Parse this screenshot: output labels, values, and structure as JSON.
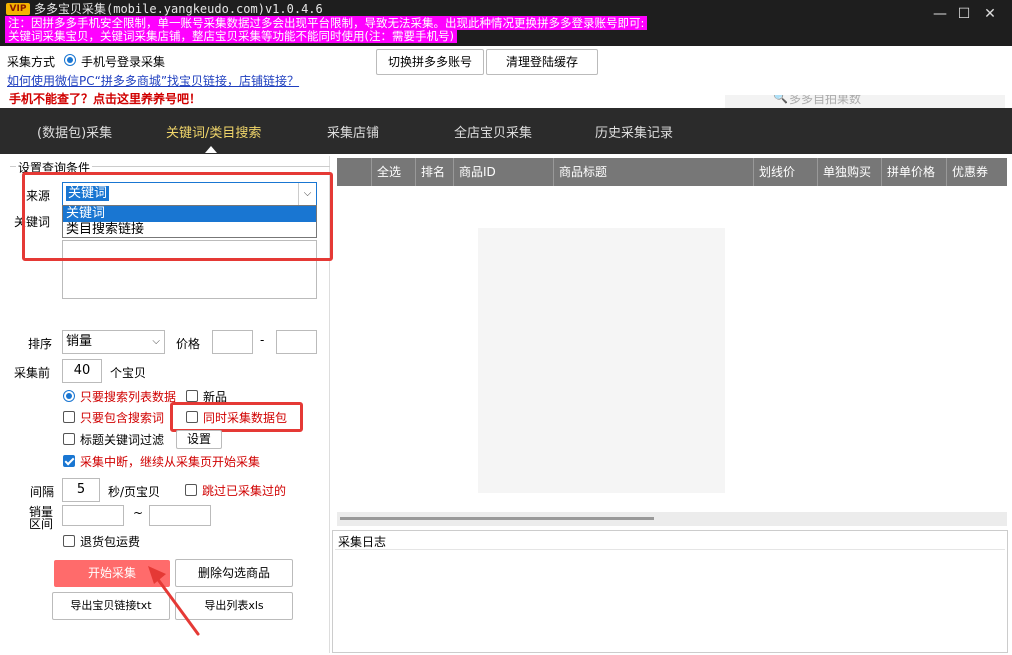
{
  "window": {
    "vip_badge": "VIP",
    "title": "多多宝贝采集(mobile.yangkeudo.com)v1.0.4.6",
    "notice_line1": "注：因拼多多手机安全限制，单一账号采集数据过多会出现平台限制，导致无法采集。出现此种情况更换拼多多登录账号即可:",
    "notice_line2": "关键词采集宝贝，关键词采集店铺，整店宝贝采集等功能不能同时使用(注：需要手机号)",
    "minimize": "—",
    "maximize": "☐",
    "close": "✕"
  },
  "top": {
    "mode_label": "采集方式",
    "mode_option": "手机号登录采集",
    "help_link": "如何使用微信PC“拼多多商城”找宝贝链接，店铺链接？",
    "warning_link": "手机不能查了？点击这里养养号吧！",
    "switch_button": "切换拼多多账号",
    "clear_button": "清理登陆缓存",
    "search_placeholder": "多多自拍果数"
  },
  "nav": {
    "tabs": [
      "(数据包)采集",
      "关键词/类目搜索",
      "采集店铺",
      "全店宝贝采集",
      "历史采集记录"
    ]
  },
  "left": {
    "group_title": "设置查询条件",
    "source_label": "来源",
    "source_value": "关键词",
    "source_options": [
      "关键词",
      "类目搜索链接"
    ],
    "keyword_label": "关键词",
    "sort_label": "排序",
    "sort_value": "销量",
    "price_label": "价格",
    "price_dash": "-",
    "collect_before_label": "采集前",
    "collect_count": "40",
    "collect_unit": "个宝贝",
    "opt_search_list": "只要搜索列表数据",
    "opt_new": "新品",
    "opt_contains_keyword": "只要包含搜索词",
    "opt_sync_packet": "同时采集数据包",
    "opt_title_filter": "标题关键词过滤",
    "settings_button": "设置",
    "opt_resume": "采集中断，继续从采集页开始采集",
    "interval_label": "间隔",
    "interval_value": "5",
    "interval_unit": "秒/页宝贝",
    "skip_collected": "跳过已采集过的",
    "sales_range_label": "销量区间",
    "tilde": "~",
    "return_shipping": "退货包运费",
    "start_button": "开始采集",
    "delete_button": "删除勾选商品",
    "export_txt_button": "导出宝贝链接txt",
    "export_xls_button": "导出列表xls"
  },
  "table": {
    "columns": [
      "全选",
      "排名",
      "商品ID",
      "商品标题",
      "划线价",
      "单独购买",
      "拼单价格",
      "优惠券"
    ]
  },
  "log": {
    "title": "采集日志"
  },
  "colors": {
    "accent": "#1976d2",
    "start_button": "#ff6b6b",
    "annotation_red": "#e53935",
    "notice_magenta": "#ff00ff"
  }
}
